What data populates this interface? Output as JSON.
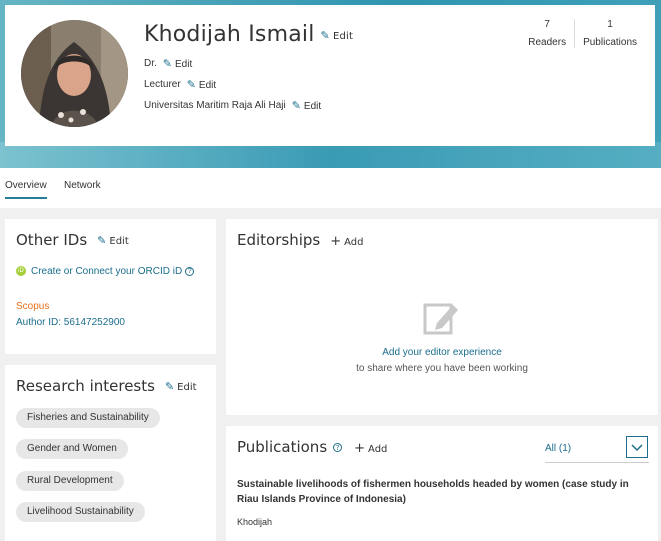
{
  "profile": {
    "name": "Khodijah Ismail",
    "edit_label": "Edit",
    "title": "Dr.",
    "position": "Lecturer",
    "institution": "Universitas Maritim Raja Ali Haji",
    "stats": [
      {
        "value": "7",
        "label": "Readers"
      },
      {
        "value": "1",
        "label": "Publications"
      }
    ]
  },
  "tabs": [
    {
      "label": "Overview"
    },
    {
      "label": "Network"
    }
  ],
  "other_ids": {
    "title": "Other IDs",
    "edit_label": "Edit",
    "orcid_icon": "iD",
    "orcid_link": "Create or Connect your ORCID iD",
    "help_icon": "?",
    "scopus_label": "Scopus",
    "author_id": "Author ID: 56147252900"
  },
  "editorships": {
    "title": "Editorships",
    "add_label": "Add",
    "empty_link": "Add your editor experience",
    "empty_text": "to share where you have been working"
  },
  "research_interests": {
    "title": "Research interests",
    "edit_label": "Edit",
    "items": [
      {
        "label": "Fisheries and Sustainability"
      },
      {
        "label": "Gender and Women"
      },
      {
        "label": "Rural Development"
      },
      {
        "label": "Livelihood Sustainability"
      }
    ]
  },
  "publications": {
    "title": "Publications",
    "help_icon": "?",
    "add_label": "Add",
    "filter_value": "All (1)",
    "items": [
      {
        "title": "Sustainable livelihoods of fishermen households headed by women (case study in Riau Islands Province of Indonesia)",
        "authors": "Khodijah"
      }
    ]
  },
  "colors": {
    "accent": "#1c6e8c",
    "banner": "#3a9bb5",
    "scopus": "#e9711c",
    "orcid": "#a6ce39"
  }
}
